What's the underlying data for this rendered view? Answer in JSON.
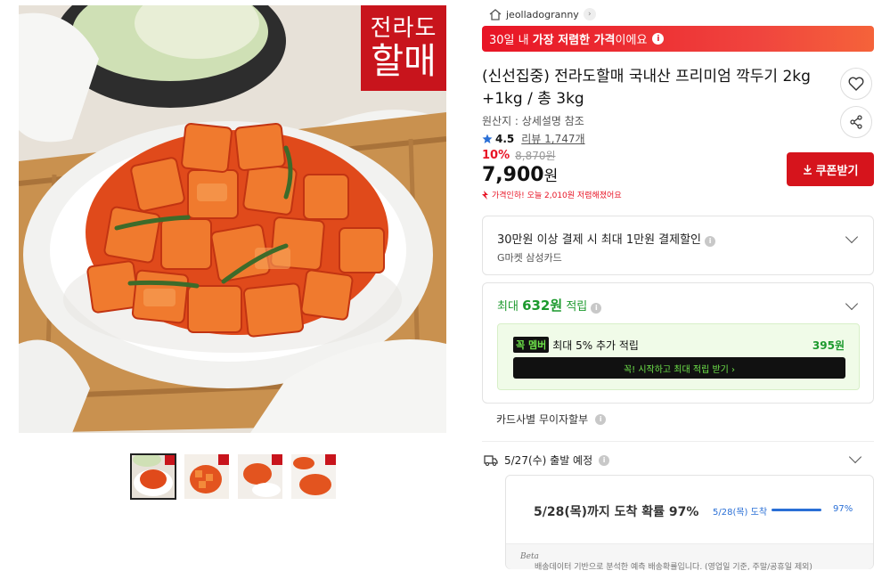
{
  "product_image": {
    "brand_stamp_line1": "전라도",
    "brand_stamp_line2": "할매",
    "thumbnail_count": 4,
    "selected_thumbnail": 1
  },
  "shop": {
    "name": "jeolladogranny"
  },
  "price_banner": {
    "prefix": "30일 내 ",
    "highlight": "가장 저렴한 가격",
    "suffix": "이에요"
  },
  "product": {
    "title": "(신선집중) 전라도할매 국내산 프리미엄 깍두기 2kg +1kg / 총 3kg",
    "origin": "원산지 : 상세설명 참조",
    "rating": "4.5",
    "review_label": "리뷰 1,747개",
    "discount": "10%",
    "original_price": "8,870원",
    "price": "7,900",
    "currency": "원",
    "price_drop_note": "가격인하! 오늘 2,010원 저렴해졌어요"
  },
  "coupon_button": {
    "label": "쿠폰받기"
  },
  "payment_benefit": {
    "title": "30만원 이상 결제 시 최대 1만원 결제할인",
    "card": "G마켓 삼성카드"
  },
  "points": {
    "prefix": "최대 ",
    "amount": "632원",
    "suffix": " 적립",
    "member_badge": "꼭 멤버",
    "member_text": "최대 5% 추가 적립",
    "member_points": "395원",
    "member_cta": "꼭! 시작하고 최대 적립 받기 ›"
  },
  "installment": {
    "label": "카드사별 무이자할부"
  },
  "shipping": {
    "departure": "5/27(수) 출발 예정",
    "arrival_text": "5/28(목)까지 도착 확률 97%",
    "bar_label": "5/28(목) 도착",
    "probability": 0.97,
    "probability_label": "97%",
    "footnote": "배송데이터 기반으로 분석한 예측 배송확률입니다. (영업일 기준, 주말/공휴일 제외)",
    "beta": "Beta"
  },
  "colors": {
    "brand_red": "#e81425",
    "point_green": "#1d9a2e",
    "link_blue": "#2a6fd6"
  }
}
